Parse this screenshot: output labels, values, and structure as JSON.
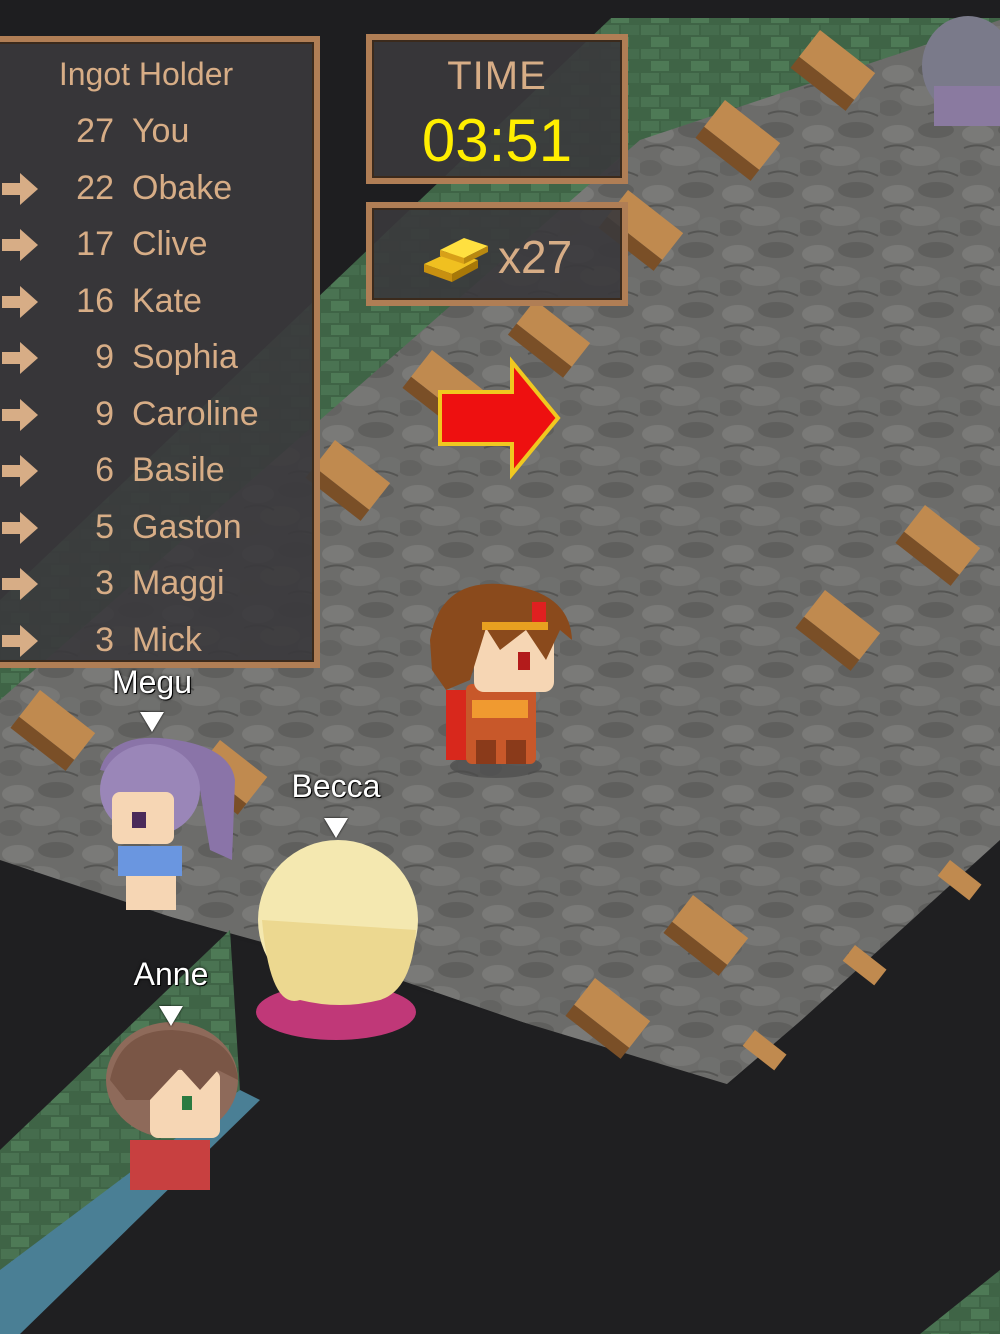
{
  "hud": {
    "leaderboard": {
      "title": "Ingot Holder",
      "rows": [
        {
          "rank": "27",
          "name": "You",
          "arrow": "none"
        },
        {
          "rank": "22",
          "name": "Obake",
          "arrow": "arrow-icon"
        },
        {
          "rank": "17",
          "name": "Clive",
          "arrow": "arrow-icon"
        },
        {
          "rank": "16",
          "name": "Kate",
          "arrow": "arrow-icon"
        },
        {
          "rank": "9",
          "name": "Sophia",
          "arrow": "arrow-icon"
        },
        {
          "rank": "9",
          "name": "Caroline",
          "arrow": "arrow-icon"
        },
        {
          "rank": "6",
          "name": "Basile",
          "arrow": "arrow-icon"
        },
        {
          "rank": "5",
          "name": "Gaston",
          "arrow": "arrow-icon"
        },
        {
          "rank": "3",
          "name": "Maggi",
          "arrow": "arrow-icon"
        },
        {
          "rank": "3",
          "name": "Mick",
          "arrow": "arrow-icon"
        }
      ]
    },
    "timer": {
      "label": "TIME",
      "value": "03:51"
    },
    "ingots": {
      "count": "x27",
      "icon": "gold-ingot-icon"
    }
  },
  "characters": {
    "megu": {
      "name": "Megu"
    },
    "becca": {
      "name": "Becca"
    },
    "anne": {
      "name": "Anne"
    }
  },
  "colors": {
    "panel_border": "#b07e55",
    "text": "#d7ad86",
    "timer": "#ffee00",
    "direction_arrow": "#ee1010"
  }
}
